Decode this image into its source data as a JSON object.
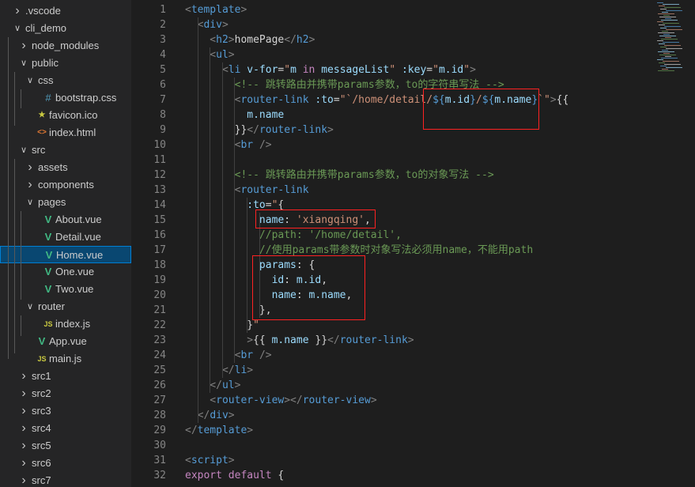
{
  "explorer": {
    "items": [
      {
        "label": ".vscode",
        "type": "folder",
        "open": false,
        "depth": 0
      },
      {
        "label": "cli_demo",
        "type": "folder",
        "open": true,
        "depth": 0
      },
      {
        "label": "node_modules",
        "type": "folder",
        "open": false,
        "depth": 1
      },
      {
        "label": "public",
        "type": "folder",
        "open": true,
        "depth": 1
      },
      {
        "label": "css",
        "type": "folder",
        "open": true,
        "depth": 2
      },
      {
        "label": "bootstrap.css",
        "type": "css",
        "depth": 3
      },
      {
        "label": "favicon.ico",
        "type": "ico",
        "depth": 2
      },
      {
        "label": "index.html",
        "type": "html",
        "depth": 2
      },
      {
        "label": "src",
        "type": "folder",
        "open": true,
        "depth": 1
      },
      {
        "label": "assets",
        "type": "folder",
        "open": false,
        "depth": 2
      },
      {
        "label": "components",
        "type": "folder",
        "open": false,
        "depth": 2
      },
      {
        "label": "pages",
        "type": "folder",
        "open": true,
        "depth": 2
      },
      {
        "label": "About.vue",
        "type": "vue",
        "depth": 3
      },
      {
        "label": "Detail.vue",
        "type": "vue",
        "depth": 3
      },
      {
        "label": "Home.vue",
        "type": "vue",
        "depth": 3,
        "selected": true
      },
      {
        "label": "One.vue",
        "type": "vue",
        "depth": 3
      },
      {
        "label": "Two.vue",
        "type": "vue",
        "depth": 3
      },
      {
        "label": "router",
        "type": "folder",
        "open": true,
        "depth": 2
      },
      {
        "label": "index.js",
        "type": "js",
        "depth": 3
      },
      {
        "label": "App.vue",
        "type": "vue",
        "depth": 2
      },
      {
        "label": "main.js",
        "type": "js",
        "depth": 2
      },
      {
        "label": "src1",
        "type": "folder",
        "open": false,
        "depth": 1
      },
      {
        "label": "src2",
        "type": "folder",
        "open": false,
        "depth": 1
      },
      {
        "label": "src3",
        "type": "folder",
        "open": false,
        "depth": 1
      },
      {
        "label": "src4",
        "type": "folder",
        "open": false,
        "depth": 1
      },
      {
        "label": "src5",
        "type": "folder",
        "open": false,
        "depth": 1
      },
      {
        "label": "src6",
        "type": "folder",
        "open": false,
        "depth": 1
      },
      {
        "label": "src7",
        "type": "folder",
        "open": false,
        "depth": 1
      }
    ]
  },
  "icons": {
    "css": "#",
    "js": "JS",
    "html": "<>",
    "vue": "V",
    "ico": "star",
    "chevron_closed": ">",
    "chevron_open": "v"
  },
  "colors": {
    "vue": "#41b883",
    "js": "#cbcb41",
    "css": "#519aba",
    "html": "#e37933",
    "ico": "#cbcb41",
    "selection": "#094771",
    "annotation": "#ff2222"
  },
  "editor": {
    "lines": [
      {
        "n": "1",
        "t": [
          [
            "t-punc",
            "<"
          ],
          [
            "t-tag",
            "template"
          ],
          [
            "t-punc",
            ">"
          ]
        ]
      },
      {
        "n": "2",
        "t": [
          [
            "t-punc",
            "  <"
          ],
          [
            "t-tag",
            "div"
          ],
          [
            "t-punc",
            ">"
          ]
        ]
      },
      {
        "n": "3",
        "t": [
          [
            "t-punc",
            "    <"
          ],
          [
            "t-tag",
            "h2"
          ],
          [
            "t-punc",
            ">"
          ],
          [
            "t-text",
            "homePage"
          ],
          [
            "t-punc",
            "</"
          ],
          [
            "t-tag",
            "h2"
          ],
          [
            "t-punc",
            ">"
          ]
        ]
      },
      {
        "n": "4",
        "t": [
          [
            "t-punc",
            "    <"
          ],
          [
            "t-tag",
            "ul"
          ],
          [
            "t-punc",
            ">"
          ]
        ]
      },
      {
        "n": "5",
        "t": [
          [
            "t-punc",
            "      <"
          ],
          [
            "t-tag",
            "li"
          ],
          [
            "t-text",
            " "
          ],
          [
            "t-attr",
            "v-for"
          ],
          [
            "t-text",
            "="
          ],
          [
            "t-str",
            "\""
          ],
          [
            "t-var",
            "m"
          ],
          [
            "t-text",
            " "
          ],
          [
            "t-kw",
            "in"
          ],
          [
            "t-text",
            " "
          ],
          [
            "t-var",
            "messageList"
          ],
          [
            "t-str",
            "\""
          ],
          [
            "t-text",
            " "
          ],
          [
            "t-attr",
            ":key"
          ],
          [
            "t-text",
            "="
          ],
          [
            "t-str",
            "\""
          ],
          [
            "t-var",
            "m.id"
          ],
          [
            "t-str",
            "\""
          ],
          [
            "t-punc",
            ">"
          ]
        ]
      },
      {
        "n": "6",
        "t": [
          [
            "t-com",
            "        <!-- 跳转路由并携带params参数，to的字符串写法 -->"
          ]
        ]
      },
      {
        "n": "7",
        "t": [
          [
            "t-punc",
            "        <"
          ],
          [
            "t-tag",
            "router-link"
          ],
          [
            "t-text",
            " "
          ],
          [
            "t-attr",
            ":to"
          ],
          [
            "t-text",
            "="
          ],
          [
            "t-str",
            "\"`/home/detail/"
          ],
          [
            "t-tpl",
            "${"
          ],
          [
            "t-var",
            "m.id"
          ],
          [
            "t-tpl",
            "}"
          ],
          [
            "t-str",
            "/"
          ],
          [
            "t-tpl",
            "${"
          ],
          [
            "t-var",
            "m.name"
          ],
          [
            "t-tpl",
            "}"
          ],
          [
            "t-str",
            "`\""
          ],
          [
            "t-punc",
            ">"
          ],
          [
            "t-text",
            "{{"
          ]
        ]
      },
      {
        "n": "8",
        "t": [
          [
            "t-var",
            "          m.name"
          ]
        ]
      },
      {
        "n": "9",
        "t": [
          [
            "t-text",
            "        }}"
          ],
          [
            "t-punc",
            "</"
          ],
          [
            "t-tag",
            "router-link"
          ],
          [
            "t-punc",
            ">"
          ]
        ]
      },
      {
        "n": "10",
        "t": [
          [
            "t-punc",
            "        <"
          ],
          [
            "t-tag",
            "br"
          ],
          [
            "t-text",
            " "
          ],
          [
            "t-punc",
            "/>"
          ]
        ]
      },
      {
        "n": "11",
        "t": []
      },
      {
        "n": "12",
        "t": [
          [
            "t-com",
            "        <!-- 跳转路由并携带params参数，to的对象写法 -->"
          ]
        ]
      },
      {
        "n": "13",
        "t": [
          [
            "t-punc",
            "        <"
          ],
          [
            "t-tag",
            "router-link"
          ]
        ]
      },
      {
        "n": "14",
        "t": [
          [
            "t-attr",
            "          :to"
          ],
          [
            "t-text",
            "="
          ],
          [
            "t-str",
            "\""
          ],
          [
            "t-text",
            "{"
          ]
        ]
      },
      {
        "n": "15",
        "t": [
          [
            "t-var",
            "            name"
          ],
          [
            "t-text",
            ": "
          ],
          [
            "t-str",
            "'xiangqing'"
          ],
          [
            "t-text",
            ","
          ]
        ]
      },
      {
        "n": "16",
        "t": [
          [
            "t-com",
            "            //path: '/home/detail',"
          ]
        ]
      },
      {
        "n": "17",
        "t": [
          [
            "t-com",
            "            //使用params带参数时对象写法必须用name，不能用path"
          ]
        ]
      },
      {
        "n": "18",
        "t": [
          [
            "t-var",
            "            params"
          ],
          [
            "t-text",
            ": {"
          ]
        ]
      },
      {
        "n": "19",
        "t": [
          [
            "t-var",
            "              id"
          ],
          [
            "t-text",
            ": "
          ],
          [
            "t-var",
            "m.id"
          ],
          [
            "t-text",
            ","
          ]
        ]
      },
      {
        "n": "20",
        "t": [
          [
            "t-var",
            "              name"
          ],
          [
            "t-text",
            ": "
          ],
          [
            "t-var",
            "m.name"
          ],
          [
            "t-text",
            ","
          ]
        ]
      },
      {
        "n": "21",
        "t": [
          [
            "t-text",
            "            },"
          ]
        ]
      },
      {
        "n": "22",
        "t": [
          [
            "t-text",
            "          }"
          ],
          [
            "t-str",
            "\""
          ]
        ]
      },
      {
        "n": "23",
        "t": [
          [
            "t-punc",
            "          >"
          ],
          [
            "t-text",
            "{{ "
          ],
          [
            "t-var",
            "m.name"
          ],
          [
            "t-text",
            " }}"
          ],
          [
            "t-punc",
            "</"
          ],
          [
            "t-tag",
            "router-link"
          ],
          [
            "t-punc",
            ">"
          ]
        ]
      },
      {
        "n": "24",
        "t": [
          [
            "t-punc",
            "        <"
          ],
          [
            "t-tag",
            "br"
          ],
          [
            "t-text",
            " "
          ],
          [
            "t-punc",
            "/>"
          ]
        ]
      },
      {
        "n": "25",
        "t": [
          [
            "t-punc",
            "      </"
          ],
          [
            "t-tag",
            "li"
          ],
          [
            "t-punc",
            ">"
          ]
        ]
      },
      {
        "n": "26",
        "t": [
          [
            "t-punc",
            "    </"
          ],
          [
            "t-tag",
            "ul"
          ],
          [
            "t-punc",
            ">"
          ]
        ]
      },
      {
        "n": "27",
        "t": [
          [
            "t-punc",
            "    <"
          ],
          [
            "t-tag",
            "router-view"
          ],
          [
            "t-punc",
            "></"
          ],
          [
            "t-tag",
            "router-view"
          ],
          [
            "t-punc",
            ">"
          ]
        ]
      },
      {
        "n": "28",
        "t": [
          [
            "t-punc",
            "  </"
          ],
          [
            "t-tag",
            "div"
          ],
          [
            "t-punc",
            ">"
          ]
        ]
      },
      {
        "n": "29",
        "t": [
          [
            "t-punc",
            "</"
          ],
          [
            "t-tag",
            "template"
          ],
          [
            "t-punc",
            ">"
          ]
        ]
      },
      {
        "n": "30",
        "t": []
      },
      {
        "n": "31",
        "t": [
          [
            "t-punc",
            "<"
          ],
          [
            "t-tag",
            "script"
          ],
          [
            "t-punc",
            ">"
          ]
        ]
      },
      {
        "n": "32",
        "t": [
          [
            "t-kw",
            "export"
          ],
          [
            "t-text",
            " "
          ],
          [
            "t-kw",
            "default"
          ],
          [
            "t-text",
            " {"
          ]
        ]
      }
    ]
  }
}
